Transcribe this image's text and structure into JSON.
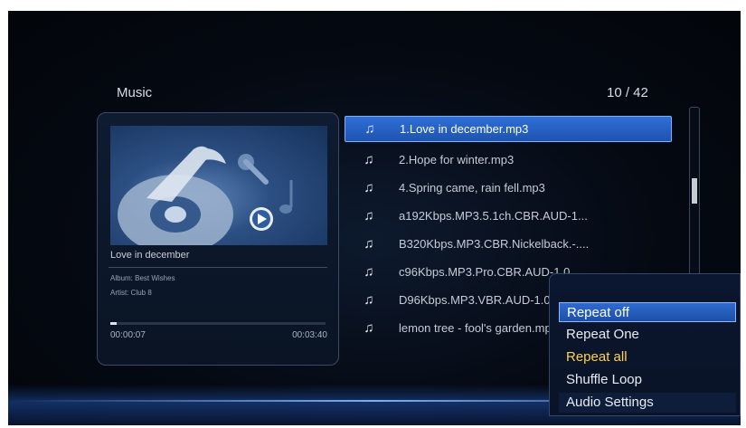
{
  "header": {
    "title": "Music",
    "counter": "10 / 42"
  },
  "now_playing": {
    "song": "Love in december",
    "album": "Album: Best Wishes",
    "artist": "Artist: Club 8",
    "elapsed": "00:00:07",
    "duration": "00:03:40",
    "progress_fraction": 0.03
  },
  "playlist": [
    {
      "label": "1.Love in december.mp3",
      "icon": "music-note-icon",
      "selected": true
    },
    {
      "label": "2.Hope for winter.mp3",
      "icon": "music-note-icon"
    },
    {
      "label": "4.Spring came, rain fell.mp3",
      "icon": "music-note-icon"
    },
    {
      "label": "a192Kbps.MP3.5.1ch.CBR.AUD-1...",
      "icon": "music-note-icon"
    },
    {
      "label": "B320Kbps.MP3.CBR.Nickelback.-....",
      "icon": "music-note-icon"
    },
    {
      "label": "c96Kbps.MP3.Pro.CBR.AUD-1.0",
      "icon": "music-note-icon"
    },
    {
      "label": "D96Kbps.MP3.VBR.AUD-1.0",
      "icon": "music-note-icon"
    },
    {
      "label": "lemon tree - fool's garden.mp3",
      "icon": "music-note-icon"
    }
  ],
  "popup_menu": [
    {
      "label": "Repeat off",
      "state": "focused"
    },
    {
      "label": "Repeat One",
      "state": "normal"
    },
    {
      "label": "Repeat all",
      "state": "active"
    },
    {
      "label": "Shuffle Loop",
      "state": "normal"
    },
    {
      "label": "Audio Settings",
      "state": "normal"
    }
  ],
  "colors": {
    "highlight": "#2f6fd6",
    "active_option": "#ffd24a",
    "background": "#050912"
  }
}
